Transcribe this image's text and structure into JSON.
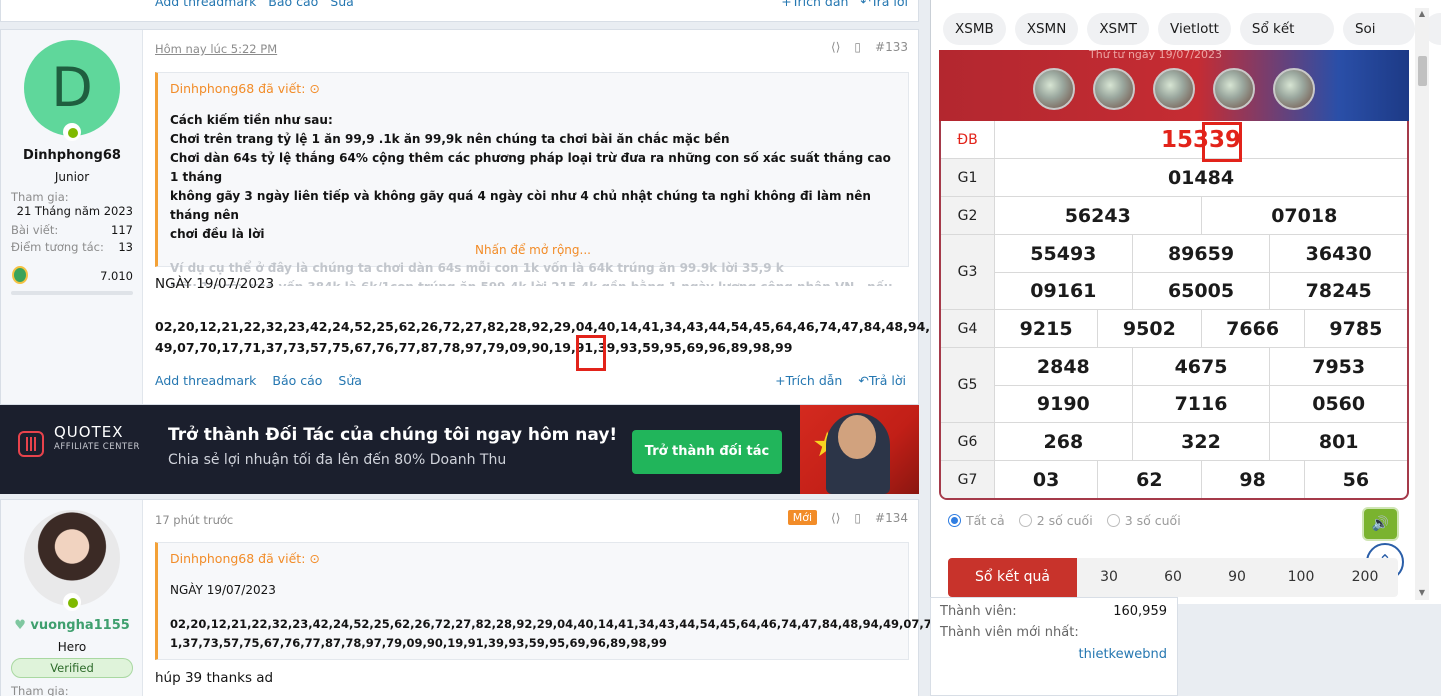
{
  "top_strip": {
    "left_actions": [
      "Add threadmark",
      "Báo cáo",
      "Sửa"
    ],
    "right_actions": [
      "Trích dẫn",
      "Trả lời"
    ]
  },
  "post133": {
    "user": {
      "avatar_letter": "D",
      "name": "Dinhphong68",
      "title": "Junior",
      "joined_label": "Tham gia:",
      "joined_value": "21 Tháng năm 2023",
      "posts_label": "Bài viết:",
      "posts_value": "117",
      "reactions_label": "Điểm tương tác:",
      "reactions_value": "13",
      "points_value": "7.010"
    },
    "time": "Hôm nay lúc 5:22 PM",
    "post_number": "#133",
    "quote": {
      "author": "Dinhphong68 đã viết:",
      "lines": [
        "Cách kiếm tiền như sau:",
        "Chơi trên trang tỷ lệ 1 ăn 99,9 .1k ăn 99,9k nên chúng ta chơi bài ăn chắc mặc bền",
        "Chơi dàn 64s tỷ lệ thắng 64% cộng thêm các phương pháp loại trừ đưa ra những con số xác suất thắng cao 1 tháng",
        "không gãy 3 ngày liên tiếp và không gãy quá 4 ngày còi như 4 chủ nhật chúng ta nghỉ không đi làm nên tháng nên",
        "chơi đều là lời"
      ],
      "faded_lines": [
        "Ví dụ cụ thể ở đây là chúng ta chơi dàn 64s mỗi con 1k vốn là 64k trúng ăn 99.9k lời 35,9 k",
        "Nếu 1 ngày vào vốn 384k là 6k/1con trúng ăn 599.4k lời 215.4k gần bằng 1 ngày lương công nhân VN , nếu gãy"
      ],
      "expand_label": "Nhấn để mở rộng..."
    },
    "date_line": "NGÀY 19/07/2023",
    "numbers_line1": "02,20,12,21,22,32,23,42,24,52,25,62,26,72,27,82,28,92,29,04,40,14,41,34,43,44,54,45,64,46,74,47,84,48,94,",
    "numbers_line2": "49,07,70,17,71,37,73,57,75,67,76,77,87,78,97,79,09,90,19,91,39,93,59,95,69,96,89,98,99",
    "actions_left": [
      "Add threadmark",
      "Báo cáo",
      "Sửa"
    ],
    "actions_right": [
      "Trích dẫn",
      "Trả lời"
    ]
  },
  "banner": {
    "brand": "QUOTEX",
    "brand_sub": "AFFILIATE CENTER",
    "headline": "Trở thành Đối Tác của chúng tôi ngay hôm nay!",
    "subline": "Chia sẻ lợi nhuận tối đa lên đến 80% Doanh Thu",
    "cta": "Trở thành đối tác"
  },
  "post134": {
    "user": {
      "name": "vuongha1155",
      "title": "Hero",
      "badge": "Verified",
      "joined_label": "Tham gia:"
    },
    "time": "17 phút trước",
    "new_badge": "Mới",
    "post_number": "#134",
    "quote": {
      "author": "Dinhphong68 đã viết:",
      "date_line": "NGÀY 19/07/2023",
      "numbers_line1": "02,20,12,21,22,32,23,42,24,52,25,62,26,72,27,82,28,92,29,04,40,14,41,34,43,44,54,45,64,46,74,47,84,48,94,49,07,70,17,7",
      "numbers_line2": "1,37,73,57,75,67,76,77,87,78,97,79,09,90,19,91,39,93,59,95,69,96,89,98,99"
    },
    "reply_text": "húp 39 thanks ad"
  },
  "lottery": {
    "tabs": [
      "XSMB",
      "XSMN",
      "XSMT",
      "Vietlott",
      "Sổ kết quả",
      "Soi cầu"
    ],
    "header_subtitle": "Thứ tư ngày 19/07/2023",
    "rows": [
      {
        "label": "ĐB",
        "lines": [
          [
            "15339"
          ]
        ]
      },
      {
        "label": "G1",
        "lines": [
          [
            "01484"
          ]
        ]
      },
      {
        "label": "G2",
        "lines": [
          [
            "56243",
            "07018"
          ]
        ]
      },
      {
        "label": "G3",
        "lines": [
          [
            "55493",
            "89659",
            "36430"
          ],
          [
            "09161",
            "65005",
            "78245"
          ]
        ]
      },
      {
        "label": "G4",
        "lines": [
          [
            "9215",
            "9502",
            "7666",
            "9785"
          ]
        ]
      },
      {
        "label": "G5",
        "lines": [
          [
            "2848",
            "4675",
            "7953"
          ],
          [
            "9190",
            "7116",
            "0560"
          ]
        ]
      },
      {
        "label": "G6",
        "lines": [
          [
            "268",
            "322",
            "801"
          ]
        ]
      },
      {
        "label": "G7",
        "lines": [
          [
            "03",
            "62",
            "98",
            "56"
          ]
        ]
      }
    ],
    "filters": [
      "Tất cả",
      "2 số cuối",
      "3 số cuối"
    ],
    "count_label": "Sổ kết quả",
    "count_options": [
      "30",
      "60",
      "90",
      "100",
      "200"
    ]
  },
  "stats": {
    "members_label": "Thành viên:",
    "members_value": "160,959",
    "newest_label": "Thành viên mới nhất:",
    "newest_value": "thietkewebnd"
  },
  "icons": {
    "share": "share-icon",
    "bookmark": "bookmark-icon",
    "online": "online-status-icon"
  },
  "colors": {
    "accent_orange": "#f28c28",
    "link_blue": "#2577b1",
    "highlight_red": "#e2231a",
    "cta_green": "#21b55b"
  }
}
